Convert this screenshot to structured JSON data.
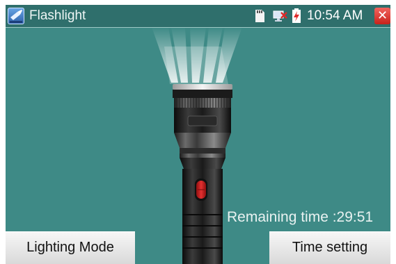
{
  "statusbar": {
    "app_title": "Flashlight",
    "app_icon": "flashlight-app-icon",
    "icons": [
      "sd-card-icon",
      "network-disconnected-icon",
      "battery-charging-icon"
    ],
    "time": "10:54 AM",
    "close_label": "✕"
  },
  "main": {
    "remaining_label": "Remaining time :29:51"
  },
  "buttons": {
    "lighting_mode": "Lighting Mode",
    "time_setting": "Time setting"
  },
  "colors": {
    "background": "#3e8a86",
    "statusbar": "#2f6f6c",
    "close": "#d9322b"
  }
}
